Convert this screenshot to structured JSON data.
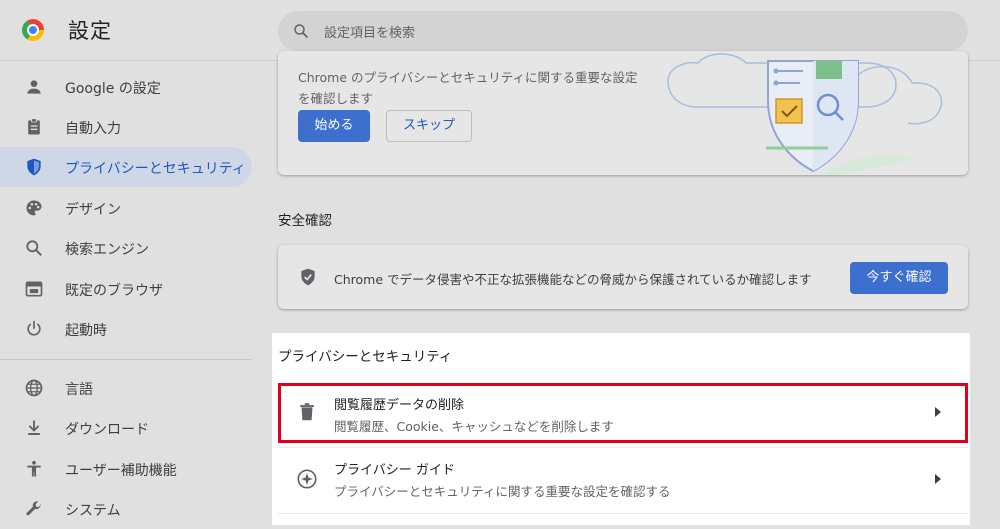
{
  "header": {
    "title": "設定",
    "logo_icon": "chrome-logo-icon",
    "search": {
      "placeholder": "設定項目を検索",
      "icon": "search-icon"
    }
  },
  "sidebar": {
    "active_color": "#1a58c2",
    "items": [
      {
        "label": "Google の設定",
        "icon": "person-icon"
      },
      {
        "label": "自動入力",
        "icon": "clipboard-icon"
      },
      {
        "label": "プライバシーとセキュリティ",
        "icon": "shield-icon",
        "active": true
      },
      {
        "label": "デザイン",
        "icon": "palette-icon"
      },
      {
        "label": "検索エンジン",
        "icon": "search-icon"
      },
      {
        "label": "既定のブラウザ",
        "icon": "browser-window-icon"
      },
      {
        "label": "起動時",
        "icon": "power-icon"
      },
      {
        "label": "言語",
        "icon": "globe-icon"
      },
      {
        "label": "ダウンロード",
        "icon": "download-icon"
      },
      {
        "label": "ユーザー補助機能",
        "icon": "accessibility-icon"
      },
      {
        "label": "システム",
        "icon": "wrench-icon"
      }
    ]
  },
  "main": {
    "privacy_guide_card": {
      "text": "Chrome のプライバシーとセキュリティに関する重要な設定を確認します",
      "start_label": "始める",
      "skip_label": "スキップ"
    },
    "safety_check": {
      "heading": "安全確認",
      "text": "Chrome でデータ侵害や不正な拡張機能などの脅威から保護されているか確認します",
      "button_label": "今すぐ確認",
      "icon": "shield-check-icon"
    },
    "privacy_section": {
      "heading": "プライバシーとセキュリティ",
      "rows": [
        {
          "title": "閲覧履歴データの削除",
          "description": "閲覧履歴、Cookie、キャッシュなどを削除します",
          "icon": "trash-icon",
          "highlighted": true
        },
        {
          "title": "プライバシー ガイド",
          "description": "プライバシーとセキュリティに関する重要な設定を確認する",
          "icon": "compass-icon"
        }
      ]
    }
  },
  "colors": {
    "primary_button": "#3d6fcf",
    "highlight_border": "#e0001b",
    "link_blue": "#1a58c2"
  }
}
